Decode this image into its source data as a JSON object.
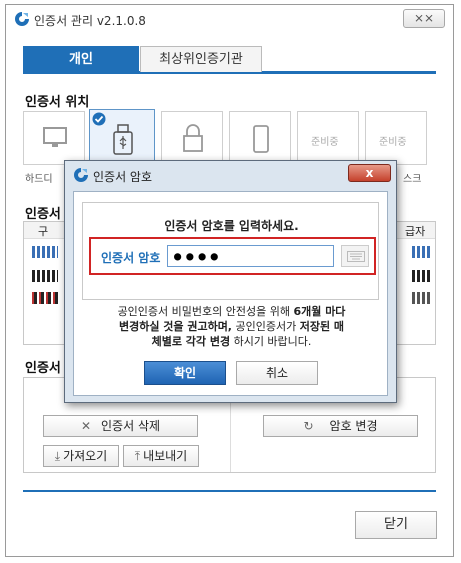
{
  "window": {
    "title": "인증서 관리 v2.1.0.8",
    "close_glyph": "⨯⨯"
  },
  "tabs": {
    "personal": "개인",
    "root": "최상위인증기관"
  },
  "location": {
    "title": "인증서 위치",
    "hdd_label": "하드디",
    "disk_suffix": "스크",
    "prep1": "준비중",
    "prep2": "준비중"
  },
  "list": {
    "title_prefix": "인증서",
    "col_first": "구",
    "col_last": "급자"
  },
  "manage": {
    "title_prefix": "인증서",
    "delete_label": "인증서 삭제",
    "import_label": "가져오기",
    "export_label": "내보내기",
    "change_pw_label": "암호 변경"
  },
  "footer": {
    "close_label": "닫기"
  },
  "dialog": {
    "title": "인증서 암호",
    "close_glyph": "x",
    "heading": "인증서 암호를 입력하세요.",
    "password_label": "인증서 암호",
    "password_value": "●●●●",
    "notice_1": "공인인증서 비밀번호의 안전성을 위해 ",
    "notice_bold_1": "6개월 마다",
    "notice_bold_2": "변경하실 것을 권고하며,",
    "notice_2": " 공인인증서가 ",
    "notice_bold_3": "저장된 매",
    "notice_bold_4": "체별로 각각 변경",
    "notice_3": " 하시기 바랍니다.",
    "ok_label": "확인",
    "cancel_label": "취소"
  },
  "colors": {
    "accent": "#1f6fb7",
    "highlight": "#d12424"
  }
}
